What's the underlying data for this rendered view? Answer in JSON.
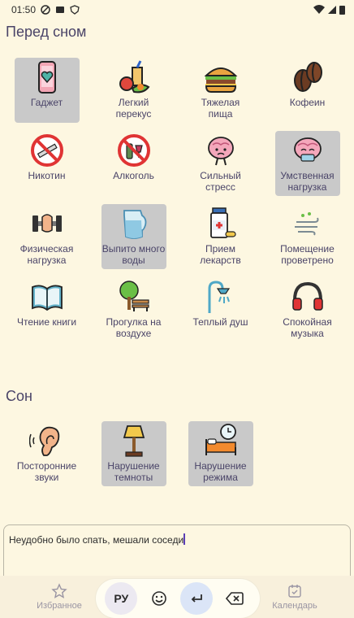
{
  "status": {
    "time": "01:50"
  },
  "sections": {
    "before_sleep": {
      "title": "Перед сном",
      "items": [
        {
          "label": "Гаджет",
          "icon": "phone-heart-icon",
          "selected": true
        },
        {
          "label": "Легкий перекус",
          "icon": "fruit-drink-icon",
          "selected": false
        },
        {
          "label": "Тяжелая пища",
          "icon": "burger-icon",
          "selected": false
        },
        {
          "label": "Кофеин",
          "icon": "coffee-beans-icon",
          "selected": false
        },
        {
          "label": "Никотин",
          "icon": "no-smoking-icon",
          "selected": false
        },
        {
          "label": "Алкоголь",
          "icon": "no-alcohol-icon",
          "selected": false
        },
        {
          "label": "Сильный стресс",
          "icon": "stressed-brain-icon",
          "selected": false
        },
        {
          "label": "Умственная нагрузка",
          "icon": "tired-brain-icon",
          "selected": true
        },
        {
          "label": "Физическая нагрузка",
          "icon": "dumbbell-icon",
          "selected": false
        },
        {
          "label": "Выпито много воды",
          "icon": "water-jug-icon",
          "selected": true
        },
        {
          "label": "Прием лекарств",
          "icon": "medicine-icon",
          "selected": false
        },
        {
          "label": "Помещение проветрено",
          "icon": "wind-icon",
          "selected": false
        },
        {
          "label": "Чтение книги",
          "icon": "book-icon",
          "selected": false
        },
        {
          "label": "Прогулка на воздухе",
          "icon": "park-bench-icon",
          "selected": false
        },
        {
          "label": "Теплый душ",
          "icon": "shower-icon",
          "selected": false
        },
        {
          "label": "Спокойная музыка",
          "icon": "headphones-icon",
          "selected": false
        }
      ]
    },
    "sleep": {
      "title": "Сон",
      "items": [
        {
          "label": "Посторонние звуки",
          "icon": "ear-icon",
          "selected": false
        },
        {
          "label": "Нарушение темноты",
          "icon": "lamp-icon",
          "selected": true
        },
        {
          "label": "Нарушение режима",
          "icon": "bed-clock-icon",
          "selected": true
        }
      ]
    }
  },
  "note": {
    "text": "Неудобно было спать, мешали соседи"
  },
  "nav": {
    "favorites": "Избранное",
    "calendar": "Календарь"
  },
  "keyboard": {
    "lang": "РУ"
  }
}
